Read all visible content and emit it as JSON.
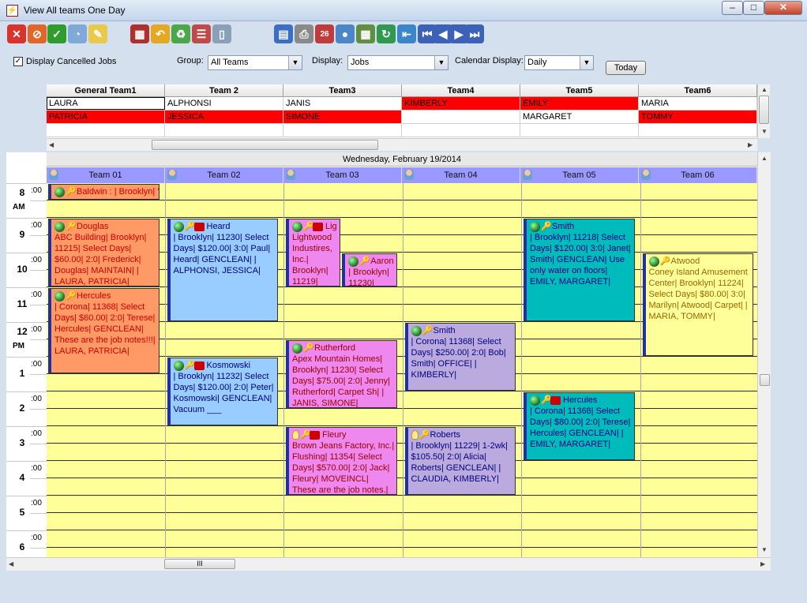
{
  "window": {
    "title": "View All teams One Day",
    "min": "–",
    "max": "□",
    "close": "✕"
  },
  "toolbar": [
    {
      "name": "cancel-icon",
      "glyph": "✕",
      "bg": "#d9332b"
    },
    {
      "name": "no-entry-icon",
      "glyph": "⊘",
      "bg": "#e0662a"
    },
    {
      "name": "ok-icon",
      "glyph": "✓",
      "bg": "#2e9d2e"
    },
    {
      "name": "refresh-globe-icon",
      "glyph": "◔",
      "bg": "#7fa9d8"
    },
    {
      "name": "pencil-icon",
      "glyph": "✎",
      "bg": "#e8c94a"
    },
    {
      "name": "delete-calendar-icon",
      "glyph": "▦",
      "bg": "#b03030"
    },
    {
      "name": "undo-folder-icon",
      "glyph": "↶",
      "bg": "#e5a823"
    },
    {
      "name": "recycle-icon",
      "glyph": "♻",
      "bg": "#4aa84a"
    },
    {
      "name": "calendar-lines-icon",
      "glyph": "☰",
      "bg": "#c04a4a"
    },
    {
      "name": "phone-icon",
      "glyph": "▯",
      "bg": "#8aa0b8"
    },
    {
      "name": "report-icon",
      "glyph": "▤",
      "bg": "#3b6fc6"
    },
    {
      "name": "print-icon",
      "glyph": "⎙",
      "bg": "#8a8a8a"
    },
    {
      "name": "calendar-26-icon",
      "glyph": "26",
      "bg": "#c23b3b"
    },
    {
      "name": "user-icon",
      "glyph": "●",
      "bg": "#4a86c8"
    },
    {
      "name": "grid-icon",
      "glyph": "▦",
      "bg": "#5f8f3f"
    },
    {
      "name": "sync-icon",
      "glyph": "↻",
      "bg": "#2f9a4f"
    },
    {
      "name": "exit-door-icon",
      "glyph": "⇤",
      "bg": "#3a86c9"
    },
    {
      "name": "first-icon",
      "glyph": "⏮",
      "bg": "#3c62b8"
    },
    {
      "name": "prev-icon",
      "glyph": "◀",
      "bg": "#3c62b8"
    },
    {
      "name": "next-icon",
      "glyph": "▶",
      "bg": "#3c62b8"
    },
    {
      "name": "last-icon",
      "glyph": "⏭",
      "bg": "#3c62b8"
    }
  ],
  "options": {
    "display_cancelled": "Display Cancelled Jobs",
    "display_cancelled_checked": "✓",
    "group_label": "Group:",
    "group_value": "All Teams",
    "display_label": "Display:",
    "display_value": "Jobs",
    "calendar_label": "Calendar Display:",
    "calendar_value": "Daily",
    "today": "Today"
  },
  "roster": {
    "headers": [
      "General Team1",
      "Team 2",
      "Team3",
      "Team4",
      "Team5",
      "Team6"
    ],
    "rows": [
      [
        {
          "t": "LAURA",
          "red": false
        },
        {
          "t": "ALPHONSI",
          "red": false
        },
        {
          "t": "JANIS",
          "red": false
        },
        {
          "t": "KIMBERLY",
          "red": true
        },
        {
          "t": "EMILY",
          "red": true
        },
        {
          "t": "MARIA",
          "red": false
        }
      ],
      [
        {
          "t": "PATRICIA",
          "red": true
        },
        {
          "t": "JESSICA",
          "red": true
        },
        {
          "t": "SIMONE",
          "red": true
        },
        {
          "t": "",
          "red": false
        },
        {
          "t": "MARGARET",
          "red": false
        },
        {
          "t": "TOMMY",
          "red": true
        }
      ],
      [
        {
          "t": "",
          "red": false
        },
        {
          "t": "",
          "red": false
        },
        {
          "t": "",
          "red": false
        },
        {
          "t": "",
          "red": false
        },
        {
          "t": "",
          "red": false
        },
        {
          "t": "",
          "red": false
        }
      ]
    ]
  },
  "calendar": {
    "date": "Wednesday, February 19/2014",
    "teams": [
      "Team 01",
      "Team 02",
      "Team 03",
      "Team 04",
      "Team 05",
      "Team 06"
    ],
    "hours": [
      {
        "h": "8",
        "m": ":00",
        "ap": "AM"
      },
      {
        "h": "9",
        "m": ":00",
        "ap": ""
      },
      {
        "h": "10",
        "m": ":00",
        "ap": ""
      },
      {
        "h": "11",
        "m": ":00",
        "ap": ""
      },
      {
        "h": "12",
        "m": ":00",
        "ap": "PM"
      },
      {
        "h": "1",
        "m": ":00",
        "ap": ""
      },
      {
        "h": "2",
        "m": ":00",
        "ap": ""
      },
      {
        "h": "3",
        "m": ":00",
        "ap": ""
      },
      {
        "h": "4",
        "m": ":00",
        "ap": ""
      },
      {
        "h": "5",
        "m": ":00",
        "ap": ""
      },
      {
        "h": "6",
        "m": ":00",
        "ap": ""
      }
    ],
    "appointments": [
      {
        "col": 0,
        "sub": 0,
        "subn": 1,
        "start": 0,
        "end": 1,
        "style": "salmon",
        "icons": [
          "ball",
          "key"
        ],
        "name": "Baldwin : | Brooklyn| '",
        "body": ""
      },
      {
        "col": 0,
        "sub": 0,
        "subn": 1,
        "start": 2,
        "end": 6,
        "style": "salmon",
        "icons": [
          "ball",
          "key"
        ],
        "name": "Douglas",
        "body": "ABC Building| Brooklyn| 11215| Select Days| $60.00| 2:0| Frederick| Douglas| MAINTAIN| | LAURA, PATRICIA|"
      },
      {
        "col": 0,
        "sub": 0,
        "subn": 1,
        "start": 6,
        "end": 11,
        "style": "salmon",
        "icons": [
          "ball",
          "key"
        ],
        "name": "Hercules",
        "body": "| Corona| 11368| Select Days| $60.00| 2:0| Terese| Hercules| GENCLEAN| These are the job notes!!!| LAURA, PATRICIA|"
      },
      {
        "col": 1,
        "sub": 0,
        "subn": 1,
        "start": 2,
        "end": 8,
        "style": "blue",
        "icons": [
          "ball",
          "key",
          "ph"
        ],
        "name": "Heard",
        "body": "| Brooklyn| 11230| Select Days| $120.00| 3:0| Paul| Heard| GENCLEAN| | ALPHONSI, JESSICA|"
      },
      {
        "col": 1,
        "sub": 0,
        "subn": 1,
        "start": 10,
        "end": 14,
        "style": "blue",
        "icons": [
          "ball",
          "key",
          "ph"
        ],
        "name": "Kosmowski",
        "body": "| Brooklyn| 11232| Select Days| $120.00| 2:0| Peter| Kosmowski| GENCLEAN| Vacuum ___"
      },
      {
        "col": 2,
        "sub": 0,
        "subn": 2,
        "start": 2,
        "end": 6,
        "style": "pink",
        "icons": [
          "ball",
          "key",
          "ph"
        ],
        "name": "Lig",
        "body": "Lightwood Industires, Inc.| Brooklyn| 11219|"
      },
      {
        "col": 2,
        "sub": 1,
        "subn": 2,
        "start": 4,
        "end": 6,
        "style": "pink",
        "icons": [
          "ball",
          "key"
        ],
        "name": "Aaron",
        "body": "| Brooklyn| 11230|"
      },
      {
        "col": 2,
        "sub": 0,
        "subn": 1,
        "start": 9,
        "end": 13,
        "style": "pink",
        "icons": [
          "ball",
          "key"
        ],
        "name": "Rutherford",
        "body": "Apex Mountain Homes| Brooklyn| 11230| Select Days| $75.00| 2:0| Jenny| Rutherford| Carpet Sh| | JANIS, SIMONE|"
      },
      {
        "col": 2,
        "sub": 0,
        "subn": 1,
        "start": 14,
        "end": 18,
        "style": "pink",
        "icons": [
          "bulb",
          "key",
          "ph"
        ],
        "name": "Fleury",
        "body": "Brown Jeans Factory, Inc.| Flushing| 11354| Select Days| $570.00| 2:0| Jack| Fleury| MOVEINCL| These are the job notes.| JANIS,"
      },
      {
        "col": 3,
        "sub": 0,
        "subn": 1,
        "start": 8,
        "end": 12,
        "style": "purple",
        "icons": [
          "ball",
          "key"
        ],
        "name": "Smith",
        "body": "| Corona| 11368| Select Days| $250.00| 2:0| Bob| Smith| OFFICE| | KIMBERLY|"
      },
      {
        "col": 3,
        "sub": 0,
        "subn": 1,
        "start": 14,
        "end": 18,
        "style": "purple",
        "icons": [
          "bulb",
          "key"
        ],
        "name": "Roberts",
        "body": "| Brooklyn| 11229| 1-2wk| $105.50| 2:0| Alicia| Roberts| GENCLEAN| | CLAUDIA, KIMBERLY|"
      },
      {
        "col": 4,
        "sub": 0,
        "subn": 1,
        "start": 2,
        "end": 8,
        "style": "teal",
        "icons": [
          "ball",
          "key"
        ],
        "name": "Smith",
        "body": "| Brooklyn| 11218| Select Days| $120.00| 3:0| Janet| Smith| GENCLEAN| Use only water on floors| EMILY, MARGARET|"
      },
      {
        "col": 4,
        "sub": 0,
        "subn": 1,
        "start": 12,
        "end": 16,
        "style": "teal",
        "icons": [
          "ball",
          "key",
          "ph"
        ],
        "name": "Hercules",
        "body": "| Corona| 11368| Select Days| $80.00| 2:0| Terese| Hercules| GENCLEAN| | EMILY, MARGARET|"
      },
      {
        "col": 5,
        "sub": 0,
        "subn": 1,
        "start": 4,
        "end": 10,
        "style": "yel",
        "icons": [
          "ball",
          "key"
        ],
        "name": "Atwood",
        "body": "Coney Island Amusement Center| Brooklyn| 11224| Select Days| $80.00| 3:0| Marilyn| Atwood| Carpet| | MARIA, TOMMY|"
      }
    ]
  },
  "scroll": {
    "hthumb": "III"
  }
}
